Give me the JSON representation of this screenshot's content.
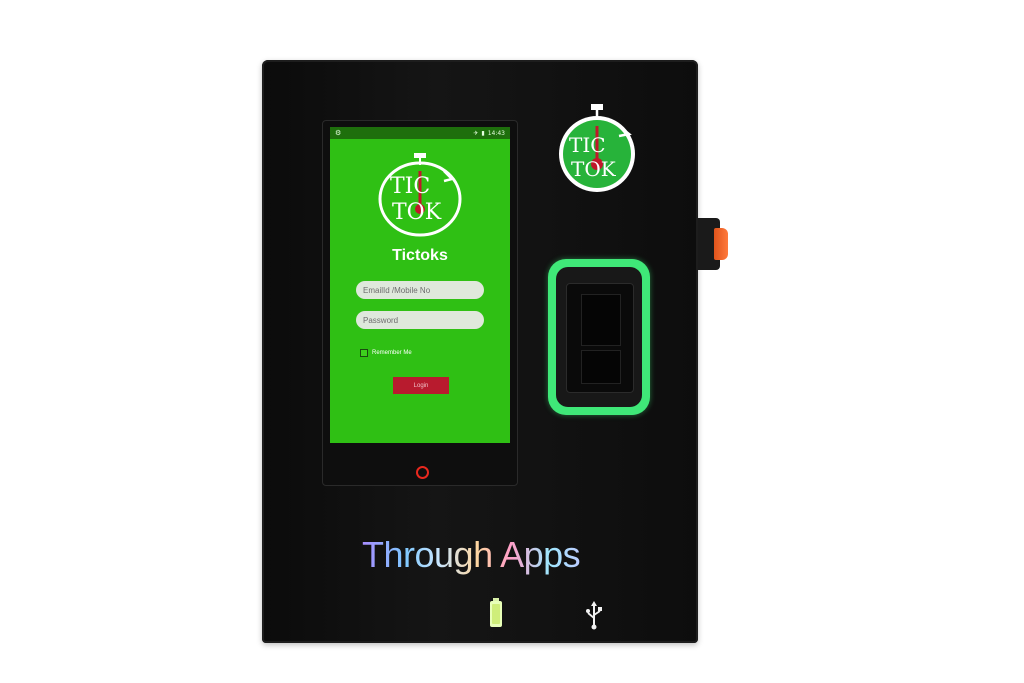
{
  "screen": {
    "status_bar": {
      "time": "14:43"
    },
    "app_title": "Tictoks",
    "logo_text": {
      "line1": "TIC",
      "line2": "TOK"
    },
    "email_field": {
      "placeholder": "EmailId /Mobile No"
    },
    "password_field": {
      "placeholder": "Password"
    },
    "remember_label": "Remember Me",
    "login_label": "Login"
  },
  "device": {
    "brand_text": "Through Apps",
    "sticker_logo_text": {
      "line1": "TIC",
      "line2": "TOK"
    }
  },
  "icons": {
    "status_left": "gear-icon",
    "status_airplane": "airplane-icon",
    "status_battery": "battery-icon",
    "fingerprint": "fingerprint-scanner-icon",
    "power": "battery-status-icon",
    "usb": "usb-icon"
  },
  "colors": {
    "screen_green": "#2fc014",
    "login_red": "#b81b2e",
    "fingerprint_ring": "#3fe878",
    "side_button": "#ff7a3c"
  }
}
